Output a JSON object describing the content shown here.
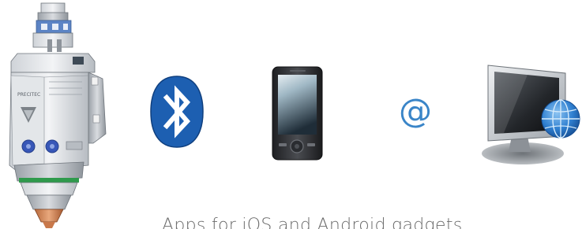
{
  "caption": "Apps for iOS and Android gadgets",
  "at_symbol": "@",
  "laser_head": {
    "label": "PRECITEC",
    "icon": "laser-cutting-head-icon"
  },
  "icons": {
    "bluetooth": "bluetooth-icon",
    "phone": "smartphone-icon",
    "at": "at-sign-icon",
    "computer": "computer-globe-icon"
  },
  "colors": {
    "bluetooth_blue": "#1d5fb1",
    "at_blue": "#3a85c8",
    "globe_blue": "#2f7fd0",
    "caption_gray": "#6b6b6b"
  }
}
